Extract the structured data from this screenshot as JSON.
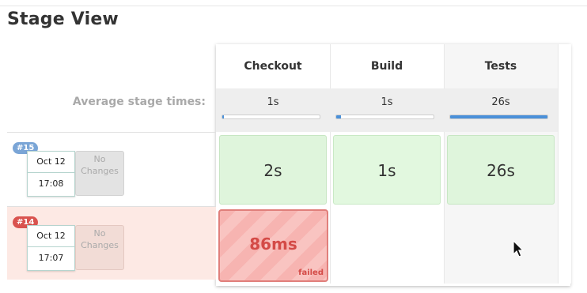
{
  "title": "Stage View",
  "stages": [
    "Checkout",
    "Build",
    "Tests"
  ],
  "average": {
    "label": "Average stage times:",
    "times": [
      "1s",
      "1s",
      "26s"
    ],
    "progress": [
      0.02,
      0.05,
      1.0
    ]
  },
  "runs": [
    {
      "badge": "#15",
      "date": "Oct 12",
      "time": "17:08",
      "changes_line1": "No",
      "changes_line2": "Changes",
      "stages": [
        {
          "value": "2s",
          "status": "success"
        },
        {
          "value": "1s",
          "status": "success"
        },
        {
          "value": "26s",
          "status": "success"
        }
      ]
    },
    {
      "badge": "#14",
      "date": "Oct 12",
      "time": "17:07",
      "changes_line1": "No",
      "changes_line2": "Changes",
      "stages": [
        {
          "value": "86ms",
          "status": "failed",
          "status_label": "failed"
        },
        {
          "value": "",
          "status": "empty"
        },
        {
          "value": "",
          "status": "empty"
        }
      ]
    }
  ],
  "colors": {
    "success_bg": "#dff5dc",
    "failed_border": "#e07f7b",
    "failed_text": "#d44b47",
    "progress_fill": "#4a90d9",
    "badge_blue": "#7aa5d6",
    "badge_red": "#d9534f"
  },
  "icons": [
    "mouse-pointer-icon"
  ]
}
